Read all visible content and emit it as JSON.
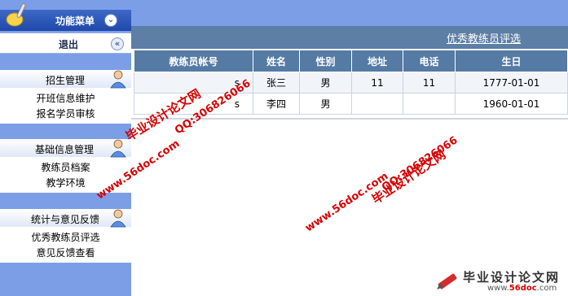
{
  "sidebar": {
    "menu_title": "功能菜单",
    "collapse_symbol": "⌄",
    "logout_label": "退出",
    "logout_symbol": "«",
    "groups": [
      {
        "title": "招生管理",
        "items": [
          "开班信息维护",
          "报名学员审核"
        ]
      },
      {
        "title": "基础信息管理",
        "items": [
          "教练员档案",
          "教学环境"
        ]
      },
      {
        "title": "统计与意见反馈",
        "items": [
          "优秀教练员评选",
          "意见反馈查看"
        ]
      }
    ]
  },
  "main": {
    "page_link": "优秀教练员评选",
    "table": {
      "headers": [
        "教练员帐号",
        "姓名",
        "性别",
        "地址",
        "电话",
        "生日"
      ],
      "rows": [
        [
          "s",
          "张三",
          "男",
          "11",
          "11",
          "1777-01-01"
        ],
        [
          "s",
          "李四",
          "男",
          "",
          "",
          "1960-01-01"
        ]
      ]
    }
  },
  "watermarks": {
    "url": "www.56doc.com",
    "qq": "QQ:306826066",
    "site_name": "毕业设计论文网",
    "brand_title": "毕业设计论文网",
    "brand_url_prefix": "www.",
    "brand_url_mid": "56doc",
    "brand_url_suffix": ".com"
  },
  "colors": {
    "sidebar_bg": "#7b9ee6",
    "header_bg": "#5d7ea5",
    "table_head": "#557aa4",
    "watermark": "#d80000"
  }
}
